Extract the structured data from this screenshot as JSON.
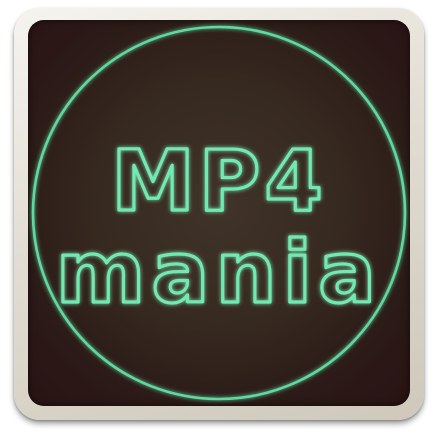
{
  "logo": {
    "line1": "MP4",
    "line2": "mania"
  },
  "colors": {
    "neon": "#73e8b0",
    "face": "#3a2d23",
    "face_edge": "#2a1314",
    "frame": "#e6e1d7"
  }
}
